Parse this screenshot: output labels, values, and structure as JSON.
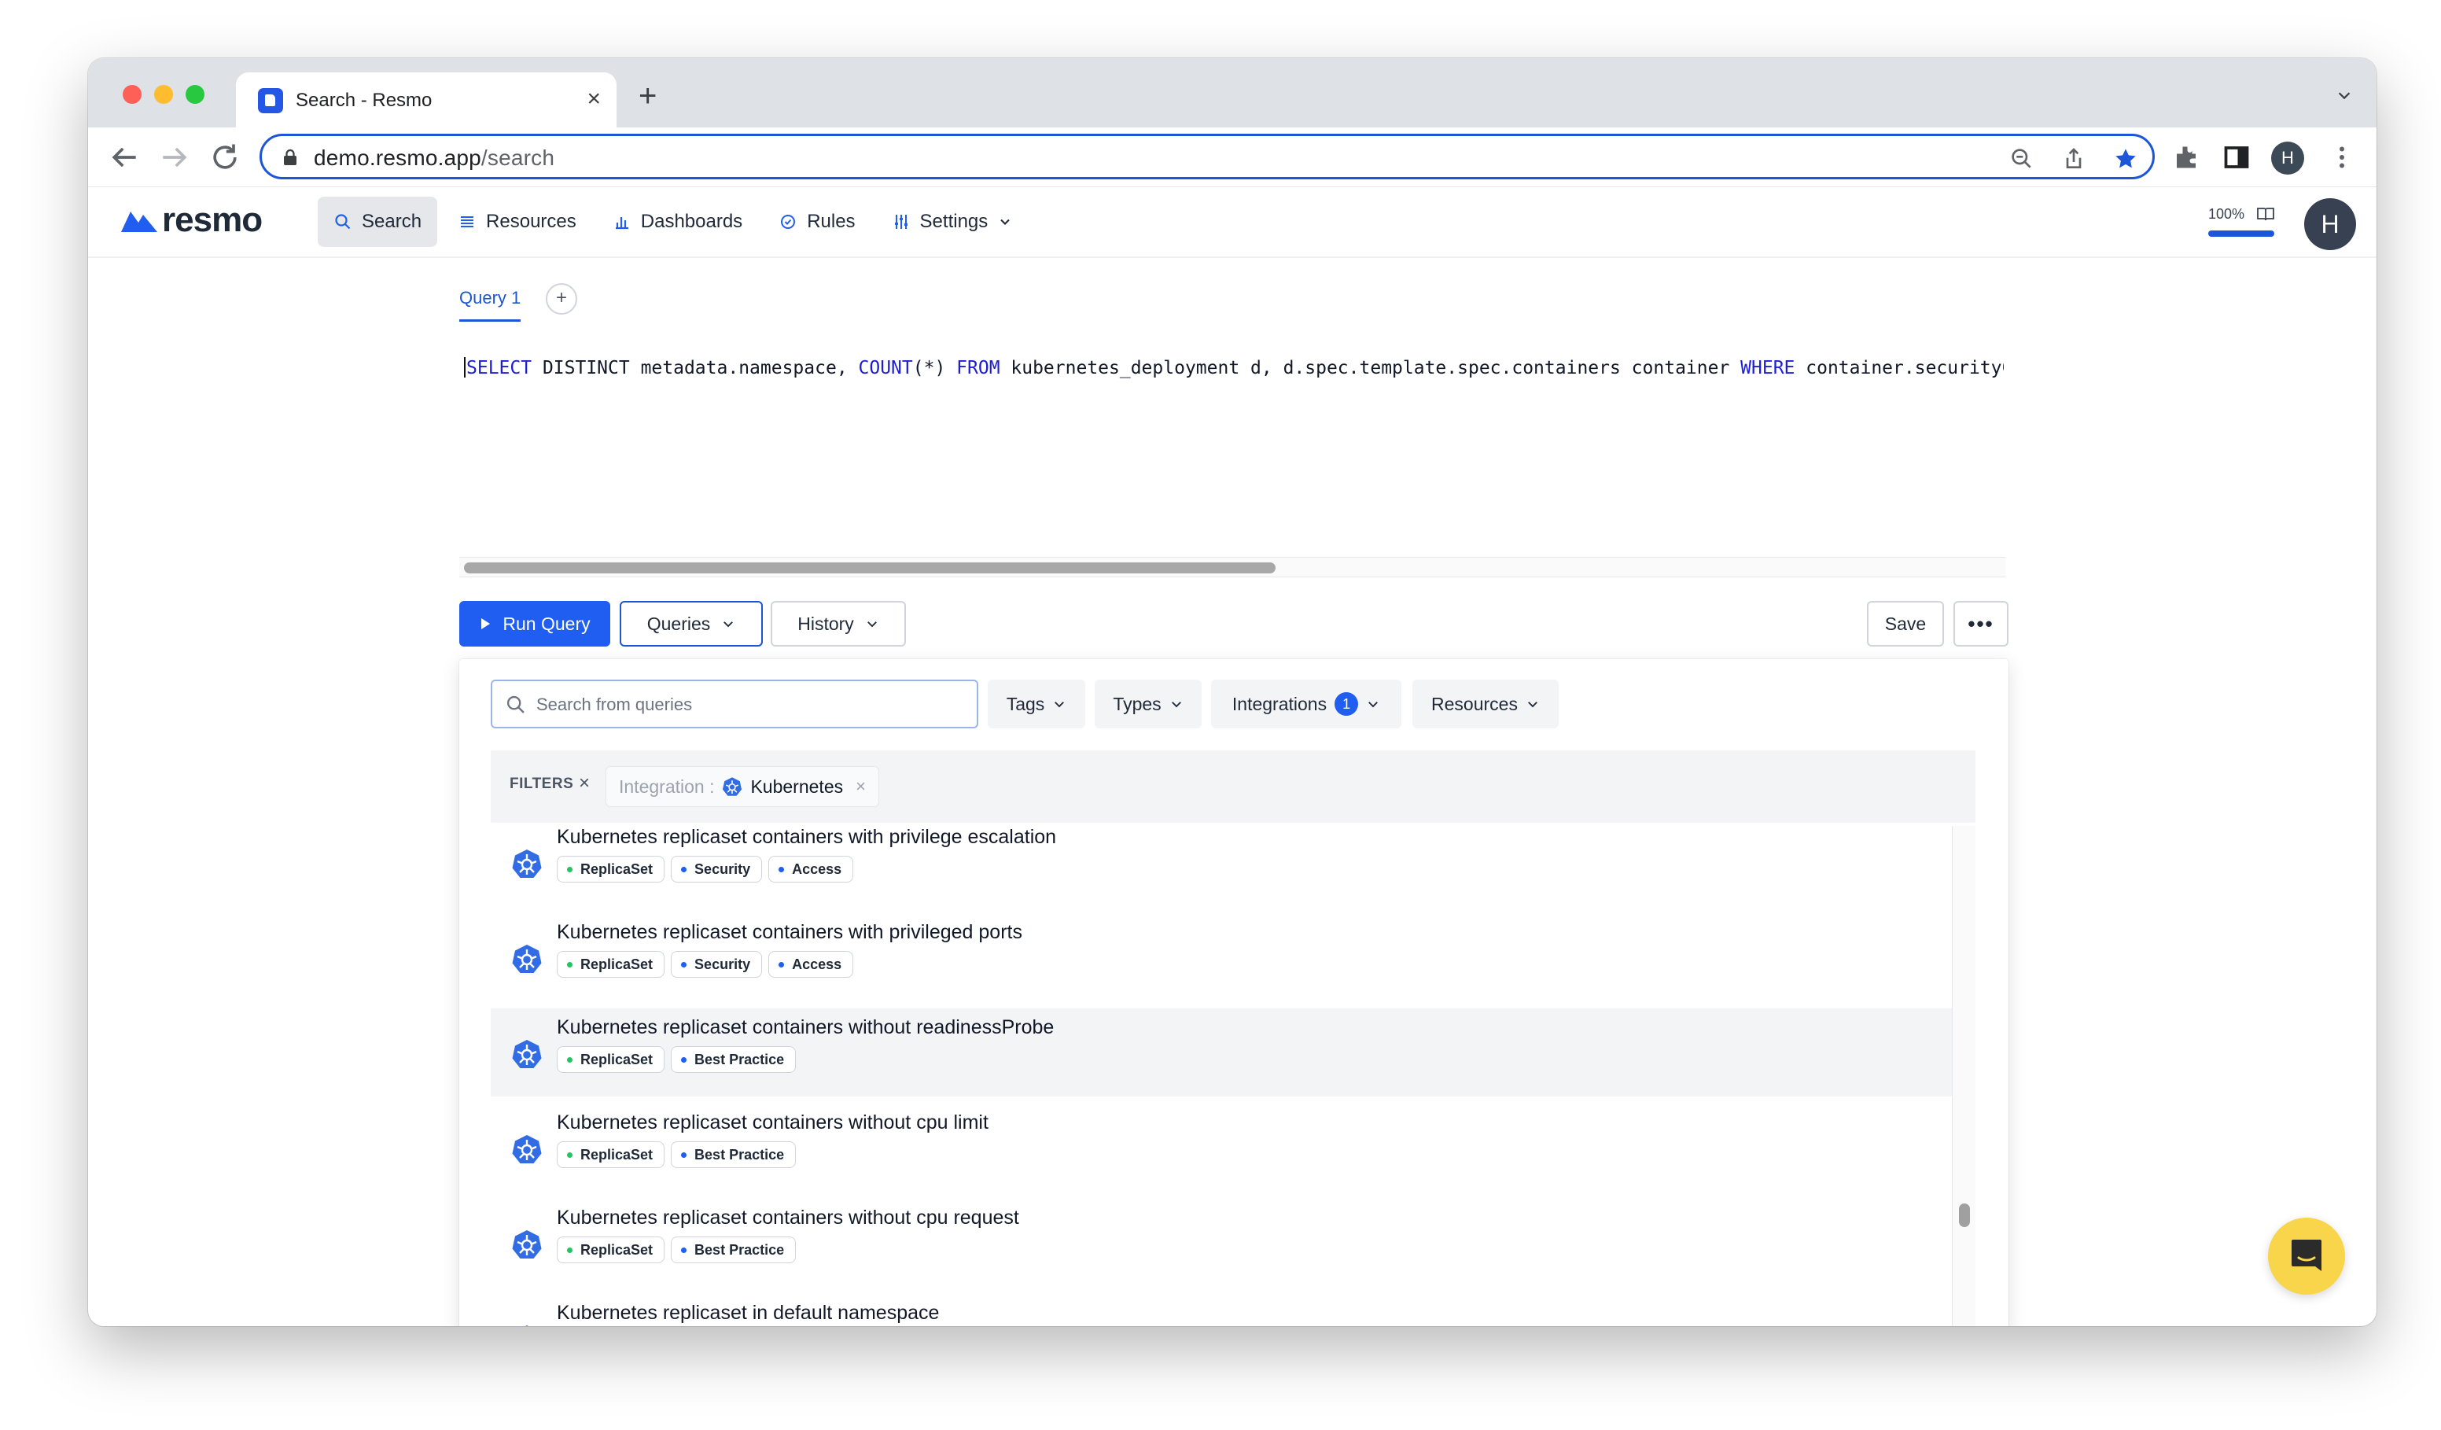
{
  "browser": {
    "tab_title": "Search - Resmo",
    "tab_close": "×",
    "new_tab": "+",
    "url_host": "demo.resmo.app",
    "url_path": "/search",
    "profile_initial": "H"
  },
  "app": {
    "logo_text": "resmo",
    "nav": [
      {
        "label": "Search",
        "icon": "search-icon",
        "active": true
      },
      {
        "label": "Resources",
        "icon": "list-icon"
      },
      {
        "label": "Dashboards",
        "icon": "bar-chart-icon"
      },
      {
        "label": "Rules",
        "icon": "check-circle-icon"
      },
      {
        "label": "Settings",
        "icon": "sliders-icon"
      }
    ],
    "zoom_label": "100%",
    "zoom_level": 1.0,
    "avatar_initial": "H",
    "accent_color": "#1f5ef0"
  },
  "editor": {
    "query_tab": "Query 1",
    "add_tab": "+",
    "sql": [
      {
        "t": "SELECT",
        "kw": true
      },
      {
        "t": " DISTINCT metadata.namespace, ",
        "kw": false
      },
      {
        "t": "COUNT",
        "kw": true
      },
      {
        "t": "(*) ",
        "kw": false
      },
      {
        "t": "FROM",
        "kw": true
      },
      {
        "t": " kubernetes_deployment d, d.spec.template.spec.containers container ",
        "kw": false
      },
      {
        "t": "WHERE",
        "kw": true
      },
      {
        "t": " container.securityContext",
        "kw": false
      }
    ],
    "run_label": "Run Query",
    "queries_label": "Queries",
    "history_label": "History",
    "save_label": "Save",
    "more_label": "•••"
  },
  "queries_panel": {
    "search_placeholder": "Search from queries",
    "filters": {
      "tags": "Tags",
      "types": "Types",
      "integrations": "Integrations",
      "integrations_count": "1",
      "resources": "Resources"
    },
    "active_filters_label": "FILTERS",
    "clear_symbol": "×",
    "chip": {
      "key": "Integration :",
      "value": "Kubernetes",
      "remove": "×"
    },
    "results": [
      {
        "title": "Kubernetes replicaset containers with privilege escalation",
        "tags": [
          {
            "label": "ReplicaSet",
            "color": "#22c55e"
          },
          {
            "label": "Security",
            "color": "#1f5ef0"
          },
          {
            "label": "Access",
            "color": "#1f5ef0"
          }
        ]
      },
      {
        "title": "Kubernetes replicaset containers with privileged ports",
        "tags": [
          {
            "label": "ReplicaSet",
            "color": "#22c55e"
          },
          {
            "label": "Security",
            "color": "#1f5ef0"
          },
          {
            "label": "Access",
            "color": "#1f5ef0"
          }
        ]
      },
      {
        "title": "Kubernetes replicaset containers without readinessProbe",
        "hover": true,
        "tags": [
          {
            "label": "ReplicaSet",
            "color": "#22c55e"
          },
          {
            "label": "Best Practice",
            "color": "#1f5ef0"
          }
        ]
      },
      {
        "title": "Kubernetes replicaset containers without cpu limit",
        "tags": [
          {
            "label": "ReplicaSet",
            "color": "#22c55e"
          },
          {
            "label": "Best Practice",
            "color": "#1f5ef0"
          }
        ]
      },
      {
        "title": "Kubernetes replicaset containers without cpu request",
        "tags": [
          {
            "label": "ReplicaSet",
            "color": "#22c55e"
          },
          {
            "label": "Best Practice",
            "color": "#1f5ef0"
          }
        ]
      },
      {
        "title": "Kubernetes replicaset in default namespace",
        "tags": []
      }
    ]
  }
}
